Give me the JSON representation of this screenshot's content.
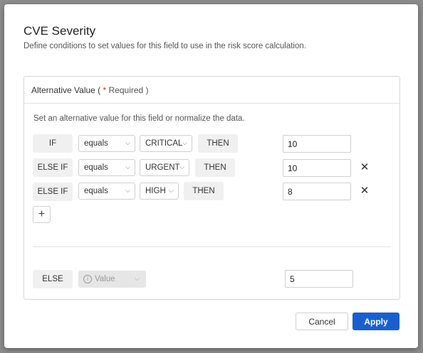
{
  "dialog": {
    "title": "CVE Severity",
    "subtitle": "Define conditions to set values for this field to use in the risk score calculation."
  },
  "panel": {
    "label": "Alternative Value (",
    "required_mark": "*",
    "required_text": "Required )",
    "description": "Set an alternative value for this field or normalize the data."
  },
  "rules": [
    {
      "condition": "IF",
      "operator": "equals",
      "match": "CRITICAL",
      "then": "THEN",
      "value": "10",
      "removable": false
    },
    {
      "condition": "ELSE IF",
      "operator": "equals",
      "match": "URGENT",
      "then": "THEN",
      "value": "10",
      "removable": true
    },
    {
      "condition": "ELSE IF",
      "operator": "equals",
      "match": "HIGH",
      "then": "THEN",
      "value": "8",
      "removable": true
    }
  ],
  "else_rule": {
    "condition": "ELSE",
    "type_placeholder": "Value",
    "value": "5"
  },
  "icons": {
    "chevron": "chevron-down-icon",
    "remove": "close-icon",
    "add": "plus-icon",
    "info": "info-icon"
  },
  "buttons": {
    "cancel": "Cancel",
    "apply": "Apply"
  },
  "colors": {
    "primary": "#1a5fd0",
    "required": "#c0392b"
  }
}
